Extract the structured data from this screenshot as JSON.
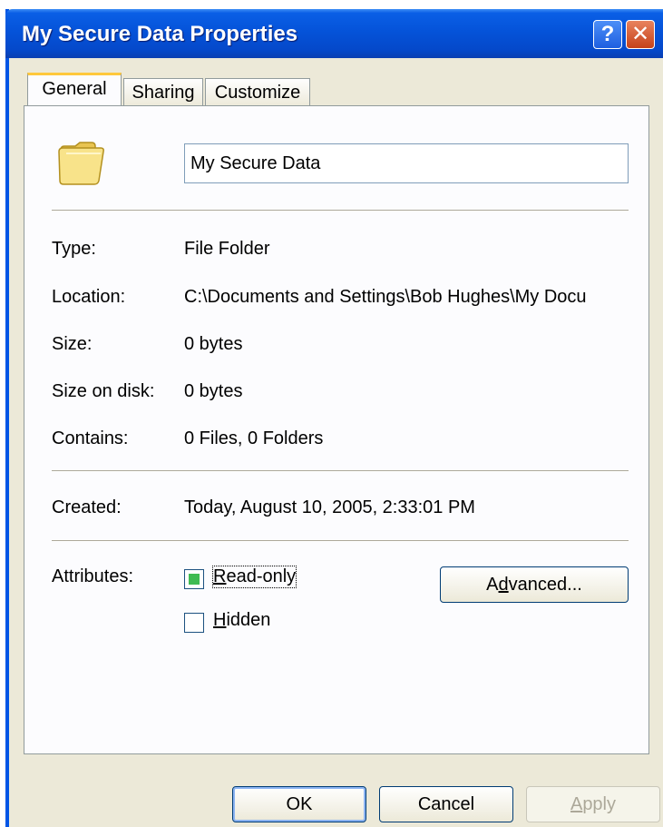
{
  "window": {
    "title": "My Secure Data Properties"
  },
  "titlebar": {
    "help_label": "?",
    "close_label": "✕"
  },
  "tabs": [
    {
      "label": "General"
    },
    {
      "label": "Sharing"
    },
    {
      "label": "Customize"
    }
  ],
  "general": {
    "name_value": "My Secure Data",
    "type_label": "Type:",
    "type_value": "File Folder",
    "location_label": "Location:",
    "location_value": "C:\\Documents and Settings\\Bob Hughes\\My Docu",
    "size_label": "Size:",
    "size_value": "0 bytes",
    "size_on_disk_label": "Size on disk:",
    "size_on_disk_value": "0 bytes",
    "contains_label": "Contains:",
    "contains_value": "0 Files, 0 Folders",
    "created_label": "Created:",
    "created_value": "Today, August 10, 2005, 2:33:01 PM",
    "attributes_label": "Attributes:",
    "readonly_label_u": "R",
    "readonly_label_rest": "ead-only",
    "hidden_label_u": "H",
    "hidden_label_rest": "idden",
    "advanced_pre": "A",
    "advanced_u": "d",
    "advanced_rest": "vanced..."
  },
  "buttons": {
    "ok": "OK",
    "cancel": "Cancel",
    "apply_u": "A",
    "apply_rest": "pply"
  },
  "colors": {
    "title_blue": "#0553d9",
    "dialog_bg": "#ece9d8",
    "checkbox_fill": "#3fbb52"
  },
  "icons": {
    "folder": "folder-icon",
    "help": "help-icon",
    "close": "close-icon"
  }
}
